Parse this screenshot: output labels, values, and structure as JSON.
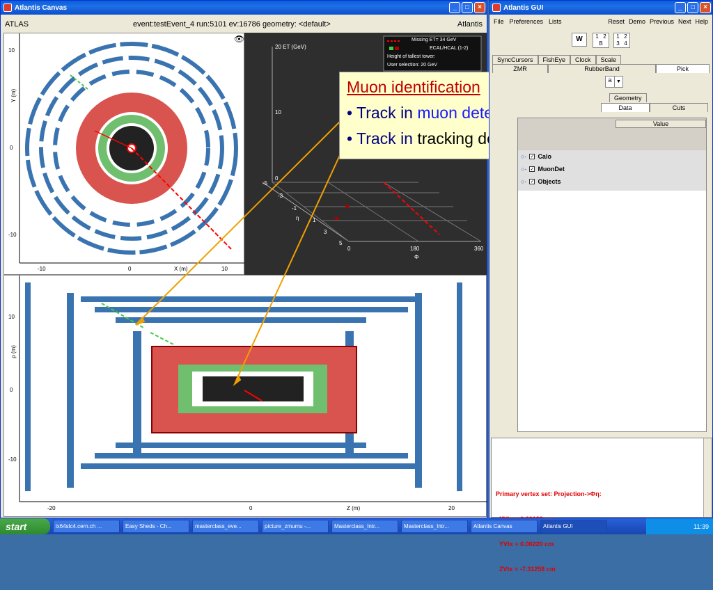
{
  "canvas": {
    "title": "Atlantis Canvas",
    "experiment": "ATLAS",
    "event_info": "event:testEvent_4 run:5101 ev:16786  geometry: <default>",
    "brand": "Atlantis",
    "xy_view": {
      "ylabel": "Y (m)",
      "xlabel": "X (m)",
      "yticks": [
        "10",
        "0",
        "-10"
      ],
      "xticks": [
        "-10",
        "0",
        "10"
      ]
    },
    "lego_view": {
      "et_axis": "20 ET (GeV)",
      "et_ticks": [
        "10",
        "0"
      ],
      "legend": [
        "Missing ET= 34 GeV",
        "ECAL/HCAL (1-2)",
        "Height of tallest tower:",
        "User selection: 20 GeV"
      ],
      "eta_label": "η",
      "phi_label": "Φ",
      "eta_ticks": [
        "-5",
        "-3",
        "-1",
        "1",
        "3",
        "5"
      ],
      "phi_ticks": [
        "0",
        "180",
        "360"
      ]
    },
    "rz_view": {
      "ylabel": "ρ (m)",
      "xlabel": "Z (m)",
      "yticks": [
        "10",
        "0",
        "-10"
      ],
      "xticks": [
        "-20",
        "0",
        "20"
      ]
    }
  },
  "callout": {
    "title": "Muon identification",
    "line1_a": "• Track in ",
    "line1_b": "muon detector",
    "line2_a": "• Track in ",
    "line2_b": "tracking detector"
  },
  "gui": {
    "title": "Atlantis GUI",
    "menu_left": [
      "File",
      "Preferences",
      "Lists"
    ],
    "menu_right": [
      "Reset",
      "Demo",
      "Previous",
      "Next",
      "Help"
    ],
    "w_button": "W",
    "layout1": [
      "1",
      "2",
      "B"
    ],
    "layout2": [
      "1",
      "2",
      "3",
      "4"
    ],
    "tabs_row1": [
      "SyncCursors",
      "FishEye",
      "Clock",
      "Scale"
    ],
    "tabs_row2": [
      "ZMR",
      "RubberBand",
      "Pick"
    ],
    "combo_value": "a",
    "tabs_row3": [
      "Geometry"
    ],
    "tabs_row4": [
      "Data",
      "Cuts"
    ],
    "table_header": "Value",
    "tree": [
      {
        "label": "Calo"
      },
      {
        "label": "MuonDet"
      },
      {
        "label": "Objects"
      }
    ],
    "output": [
      "Primary vertex set: Projection->Φη:",
      "  XVtx = 0.00182 cm",
      "  YVtx = 0.00220 cm",
      "  ZVtx = -7.31258 cm"
    ]
  },
  "taskbar": {
    "start": "start",
    "tasks": [
      "lx64slc4.cern.ch ...",
      "Easy Sheds - Ch...",
      "masterclass_eve...",
      "picture_zmumu -...",
      "Masterclass_Intr...",
      "Masterclass_Intr...",
      "Atlantis Canvas",
      "Atlantis GUI"
    ],
    "clock": "11:39"
  },
  "colors": {
    "lar": "#d9534f",
    "tile": "#6fbf6f",
    "muon": "#3a74b0",
    "track": "#ff0000"
  }
}
